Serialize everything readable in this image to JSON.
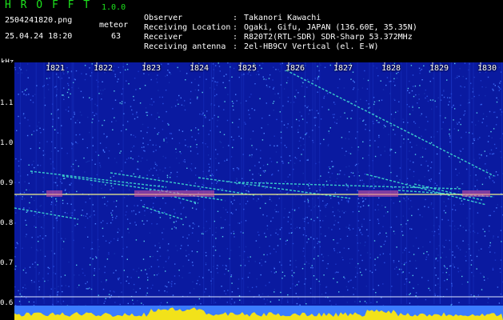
{
  "app": {
    "name": "H R O F F T",
    "version": "1.0.0"
  },
  "file": {
    "name": "2504241820.png",
    "datetime": "25.04.24 18:20"
  },
  "detection": {
    "label": "meteor",
    "count": "63"
  },
  "info": [
    {
      "label": "Observer",
      "sep": ":",
      "value": "Takanori Kawachi"
    },
    {
      "label": "Receiving Location",
      "sep": ":",
      "value": "Ogaki, Gifu, JAPAN (136.60E, 35.35N)"
    },
    {
      "label": "Receiver",
      "sep": ":",
      "value": "R820T2(RTL-SDR) SDR-Sharp 53.372MHz"
    },
    {
      "label": "Receiving antenna",
      "sep": ":",
      "value": "2el-HB9CV Vertical (el. E-W)"
    }
  ],
  "axis": {
    "unit": "kHz",
    "y_ticks": [
      "1.1",
      "1.0",
      "0.9",
      "0.8",
      "0.7",
      "0.6"
    ],
    "x_ticks": [
      "1821",
      "1822",
      "1823",
      "1824",
      "1825",
      "1826",
      "1827",
      "1828",
      "1829",
      "1830"
    ]
  },
  "colors": {
    "background": "#0a1aa0",
    "logo": "#1de31d",
    "carrier": "#f4f48a",
    "echo": "#3fe0d0",
    "bottom": "#f2e21a"
  }
}
